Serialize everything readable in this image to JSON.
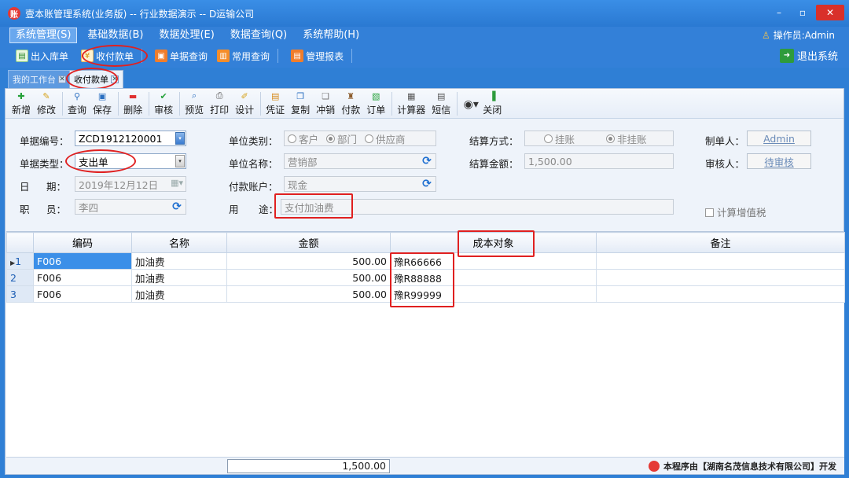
{
  "window": {
    "title": "壹本账管理系统(业务版) -- 行业数据演示 -- D运输公司",
    "minimize": "–",
    "maximize": "▫",
    "close": "✕"
  },
  "menubar": {
    "items": [
      "系统管理(S)",
      "基础数据(B)",
      "数据处理(E)",
      "数据查询(Q)",
      "系统帮助(H)"
    ],
    "operator": "操作员:Admin"
  },
  "toolbar": {
    "items": [
      "出入库单",
      "收付款单",
      "单据查询",
      "常用查询",
      "管理报表"
    ],
    "exit": "退出系统"
  },
  "tabs": {
    "workbench": "我的工作台",
    "current": "收付款单"
  },
  "doc_toolbar": {
    "buttons": [
      "新增",
      "修改",
      "查询",
      "保存",
      "删除",
      "审核",
      "预览",
      "打印",
      "设计",
      "凭证",
      "复制",
      "冲销",
      "付款",
      "订单",
      "计算器",
      "短信",
      "关闭"
    ]
  },
  "form": {
    "doc_no_label": "单据编号：",
    "doc_no": "ZCD1912120001",
    "doc_type_label": "单据类型：",
    "doc_type": "支出单",
    "date_label_a": "日",
    "date_label_b": "期：",
    "date": "2019年12月12日",
    "staff_label_a": "职",
    "staff_label_b": "员：",
    "staff": "李四",
    "unit_type_label": "单位类别：",
    "unit_type_options": [
      "客户",
      "部门",
      "供应商"
    ],
    "unit_name_label": "单位名称：",
    "unit_name": "营销部",
    "account_label": "付款账户：",
    "account": "现金",
    "purpose_label_a": "用",
    "purpose_label_b": "途：",
    "purpose": "支付加油费",
    "settle_label": "结算方式：",
    "settle_options": [
      "挂账",
      "非挂账"
    ],
    "amount_label": "结算金额：",
    "amount": "1,500.00",
    "maker_label": "制单人：",
    "maker": "Admin",
    "auditor_label": "审核人：",
    "auditor": "待审核",
    "vat_label": "计算增值税"
  },
  "grid": {
    "headers": [
      "编码",
      "名称",
      "金额",
      "成本对象",
      "备注"
    ],
    "rows": [
      {
        "n": "1",
        "code": "F006",
        "name": "加油费",
        "amount": "500.00",
        "cost": "豫R66666",
        "note": ""
      },
      {
        "n": "2",
        "code": "F006",
        "name": "加油费",
        "amount": "500.00",
        "cost": "豫R88888",
        "note": ""
      },
      {
        "n": "3",
        "code": "F006",
        "name": "加油费",
        "amount": "500.00",
        "cost": "豫R99999",
        "note": ""
      }
    ],
    "total": "1,500.00"
  },
  "credit": "本程序由【湖南名茂信息技术有限公司】开发"
}
